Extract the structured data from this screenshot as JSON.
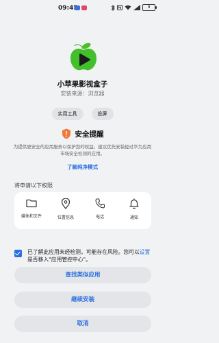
{
  "status_bar": {
    "time": "09:45",
    "battery": "9"
  },
  "app": {
    "name": "小苹果影视盒子",
    "source_label": "安装来源：",
    "source_value": "浏览器"
  },
  "tags": [
    "实用工具",
    "投屏"
  ],
  "security": {
    "title": "安全提醒",
    "description": "为提供更安全的应用服务以保护您的权益，建议优先安装经过华为应用市场安全检测的应用。",
    "pure_mode_link": "了解纯净模式"
  },
  "permissions": {
    "heading": "将申请以下权限",
    "items": [
      {
        "label": "媒体和文件",
        "icon": "folder-icon"
      },
      {
        "label": "位置信息",
        "icon": "location-icon"
      },
      {
        "label": "电话",
        "icon": "phone-icon"
      },
      {
        "label": "通知",
        "icon": "bell-icon"
      }
    ]
  },
  "consent": {
    "checked": true,
    "text_before": "已了解此应用未经检测，可能存在风险。您可以",
    "link": "设置",
    "text_after": "是否移入\"应用管控中心\"。"
  },
  "buttons": {
    "find_similar": "查找类似应用",
    "continue": "继续安装",
    "cancel": "取消"
  },
  "colors": {
    "accent": "#2a6fe0",
    "warning": "#f07a3a",
    "app_green": "#3fbf2a"
  }
}
